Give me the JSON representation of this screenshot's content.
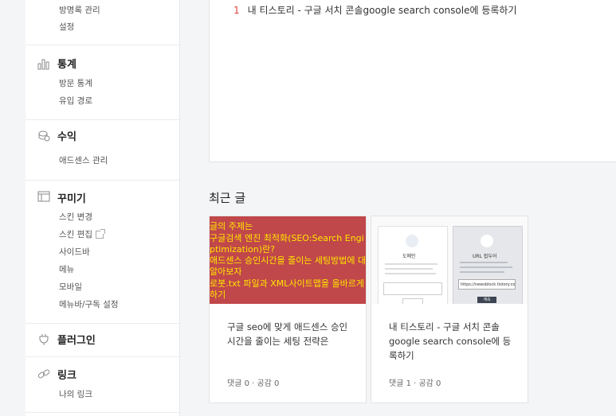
{
  "sidebar": {
    "top_items": [
      "방명록 관리",
      "설정"
    ],
    "stats": {
      "title": "통계",
      "items": [
        "방문 통계",
        "유입 경로"
      ]
    },
    "revenue": {
      "title": "수익",
      "items": [
        "애드센스 관리"
      ]
    },
    "decorate": {
      "title": "꾸미기",
      "items": [
        "스킨 변경",
        "스킨 편집",
        "사이드바",
        "메뉴",
        "모바일",
        "메뉴바/구독 설정"
      ]
    },
    "plugin": {
      "title": "플러그인"
    },
    "link": {
      "title": "링크",
      "items": [
        "나의 링크"
      ]
    }
  },
  "popular": {
    "rank": "1",
    "title": "내 티스토리 - 구글 서치 콘솔google search console에 등록하기"
  },
  "recent": {
    "title": "최근 글",
    "posts": [
      {
        "thumb_lines": [
          "글의 주제는",
          "구글검색 엔진 최적화(SEO:Search Engi",
          "ptimization)란?",
          "애드센스 승인시간을 줄이는 세팅방법에 대",
          "알아보자",
          "로봇.txt 파일과 XML사이트맵을 올바르게",
          "하기"
        ],
        "title": "구글 seo에 맞게 애드센스 승인시간을 줄이는 세팅 전략은",
        "meta": "댓글 0 · 공감 0"
      },
      {
        "thumb_left_label": "도메인",
        "thumb_right_label": "URL 접두어",
        "thumb_url": "https://newsblock.tistory.com/",
        "thumb_btn": "계속",
        "title": "내 티스토리 - 구글 서치 콘솔google search console에 등록하기",
        "meta": "댓글 1 · 공감 0"
      }
    ]
  }
}
